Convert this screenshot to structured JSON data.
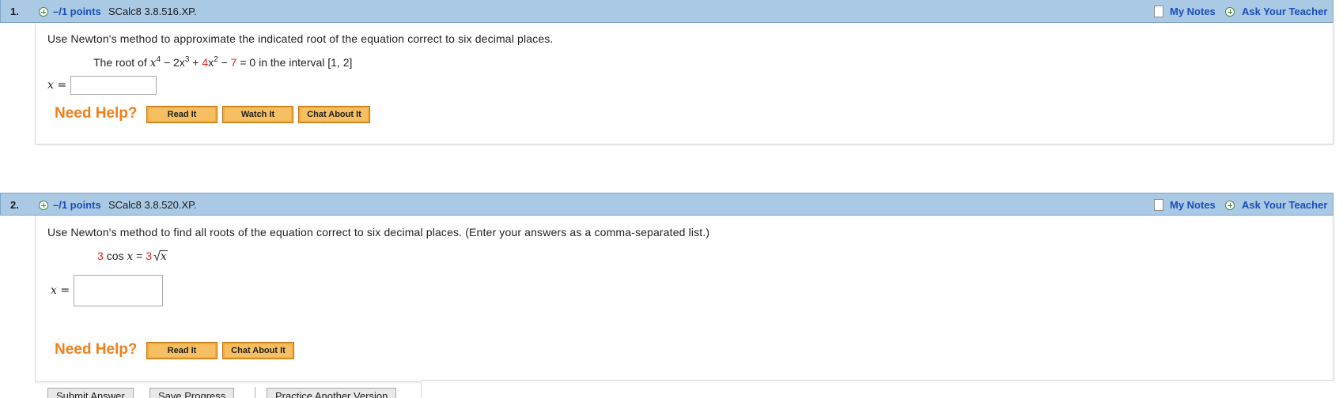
{
  "questions": [
    {
      "number": "1.",
      "points": "–/1 points",
      "source": "SCalc8 3.8.516.XP.",
      "my_notes": "My Notes",
      "ask_teacher": "Ask Your Teacher",
      "prompt": "Use Newton's method to approximate the indicated root of the equation correct to six decimal places.",
      "math": {
        "lead": "The root of",
        "term1_base": "x",
        "term1_exp": "4",
        "minus1": "− 2x",
        "term2_exp": "3",
        "plus": "+",
        "coef": "4",
        "term3_base": "x",
        "term3_exp": "2",
        "minus2": "−",
        "constant": "7",
        "equals": "= 0",
        "interval_text": "in the interval",
        "interval": "[1, 2]"
      },
      "answer_label": "x =",
      "answer_value": "",
      "need_help": "Need Help?",
      "buttons": [
        "Read It",
        "Watch It",
        "Chat About It"
      ]
    },
    {
      "number": "2.",
      "points": "–/1 points",
      "source": "SCalc8 3.8.520.XP.",
      "my_notes": "My Notes",
      "ask_teacher": "Ask Your Teacher",
      "prompt": "Use Newton's method to find all roots of the equation correct to six decimal places. (Enter your answers as a comma-separated list.)",
      "math": {
        "coef_left": "3",
        "cos_text": "cos",
        "var": "x",
        "equals": "=",
        "coef_right": "3",
        "radicand": "x"
      },
      "answer_label": "x =",
      "answer_value": "",
      "need_help": "Need Help?",
      "buttons": [
        "Read It",
        "Chat About It"
      ]
    }
  ],
  "footer": {
    "submit": "Submit Answer",
    "save": "Save Progress",
    "practice": "Practice Another Version"
  },
  "colors": {
    "header_bg": "#a9c9e4",
    "link_blue": "#1a4fb7",
    "help_orange": "#ef7f1a",
    "button_bg": "#f6bf61",
    "red_value": "#e11f1f"
  },
  "icons": {
    "expand": "plus-circle-icon",
    "notes": "note-page-icon",
    "teacher": "plus-circle-icon"
  }
}
